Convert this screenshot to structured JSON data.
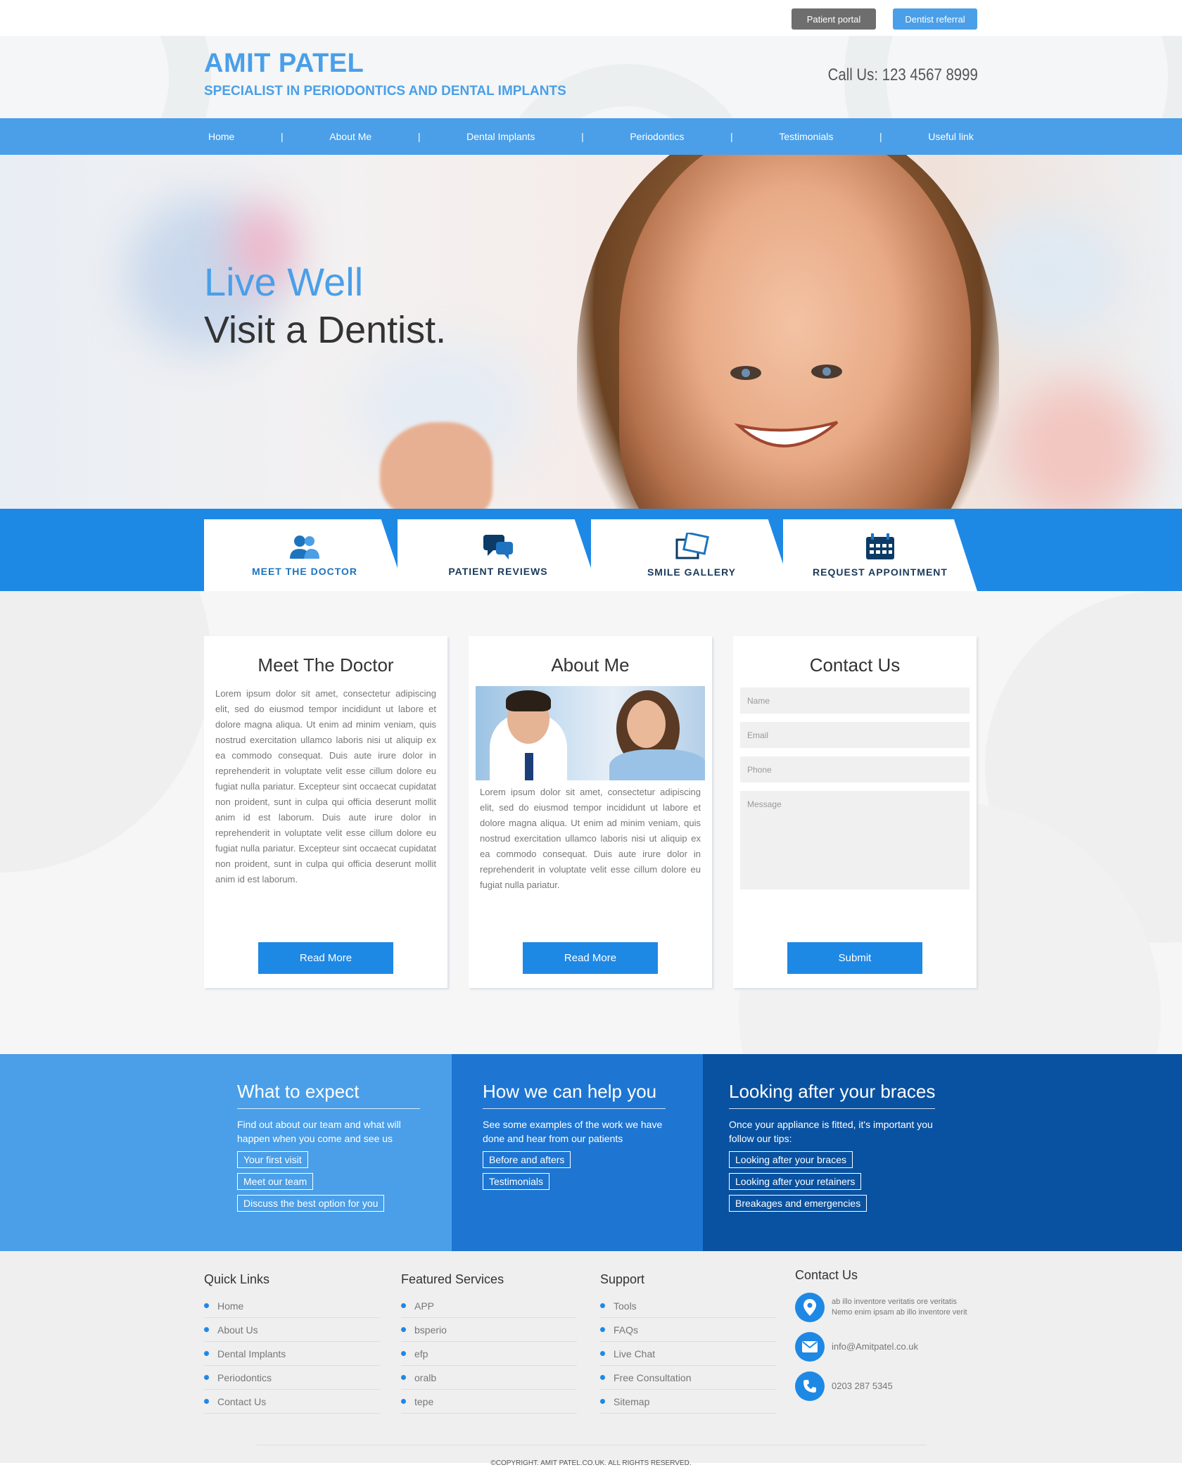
{
  "topbar": {
    "patient_portal": "Patient portal",
    "dentist_referral": "Dentist referral"
  },
  "header": {
    "name": "AMIT PATEL",
    "tagline": "SPECIALIST IN PERIODONTICS AND DENTAL IMPLANTS",
    "call": "Call Us: 123 4567 8999"
  },
  "nav": {
    "items": [
      "Home",
      "About Me",
      "Dental Implants",
      "Periodontics",
      "Testimonials",
      "Useful link"
    ],
    "separator": "|"
  },
  "hero": {
    "line1": "Live Well",
    "line2": "Visit a Dentist."
  },
  "tabs": [
    {
      "label": "MEET THE DOCTOR",
      "icon": "users-icon"
    },
    {
      "label": "PATIENT REVIEWS",
      "icon": "chat-bubbles-icon"
    },
    {
      "label": "SMILE GALLERY",
      "icon": "photos-icon"
    },
    {
      "label": "REQUEST APPOINTMENT",
      "icon": "calendar-icon"
    }
  ],
  "cards": {
    "doctor": {
      "title": "Meet The Doctor",
      "text": "Lorem ipsum dolor sit amet, consectetur adipiscing elit, sed do eiusmod tempor incididunt ut labore et dolore magna aliqua. Ut enim ad minim veniam, quis nostrud exercitation ullamco laboris nisi ut aliquip ex ea commodo consequat. Duis aute irure dolor in reprehenderit in voluptate velit esse cillum dolore eu fugiat nulla pariatur. Excepteur sint occaecat cupidatat non proident, sunt in culpa qui officia deserunt mollit anim id est laborum. Duis aute irure dolor in reprehenderit in voluptate velit esse cillum dolore eu fugiat nulla pariatur. Excepteur sint occaecat cupidatat non proident, sunt in culpa qui officia deserunt mollit anim id est laborum.",
      "button": "Read More"
    },
    "about": {
      "title": "About Me",
      "text": "Lorem ipsum dolor sit amet, consectetur adipiscing elit, sed do eiusmod tempor incididunt ut labore et dolore magna aliqua. Ut enim ad minim veniam, quis nostrud exercitation ullamco laboris nisi ut aliquip ex ea commodo consequat. Duis aute irure dolor in reprehenderit in voluptate velit esse cillum dolore eu fugiat nulla pariatur.",
      "button": "Read More"
    },
    "contact": {
      "title": "Contact Us",
      "name_ph": "Name",
      "email_ph": "Email",
      "phone_ph": "Phone",
      "message_ph": "Message",
      "button": "Submit"
    }
  },
  "band": {
    "expect": {
      "title": "What to expect",
      "desc": "Find out about our team and what will happen when you come and see us",
      "links": [
        "Your first visit",
        "Meet our team",
        "Discuss the best option for you"
      ]
    },
    "help": {
      "title": "How we can help you",
      "desc": "See some examples of the work we have done and hear from our patients",
      "links": [
        "Before and afters",
        "Testimonials"
      ]
    },
    "braces": {
      "title": "Looking after your braces",
      "desc": "Once your appliance is fitted, it's important you follow our tips:",
      "links": [
        "Looking after your braces",
        "Looking after your retainers",
        "Breakages and emergencies"
      ]
    }
  },
  "footer": {
    "quick": {
      "title": "Quick Links",
      "items": [
        "Home",
        "About Us",
        "Dental Implants",
        "Periodontics",
        "Contact Us"
      ]
    },
    "featured": {
      "title": "Featured Services",
      "items": [
        "APP",
        "bsperio",
        "efp",
        "oralb",
        "tepe"
      ]
    },
    "support": {
      "title": "Support",
      "items": [
        "Tools",
        "FAQs",
        "Live Chat",
        "Free Consultation",
        "Sitemap"
      ]
    },
    "contact": {
      "title": "Contact Us",
      "address": "ab illo inventore veritatis ore veritatis Nemo enim ipsam  ab illo inventore verit",
      "email": "info@Amitpatel.co.uk",
      "phone": "0203 287 5345"
    },
    "copyright": "©COPYRIGHT. AMIT PATEL.CO.UK. ALL RIGHTS RESERVED."
  },
  "colors": {
    "accent": "#4a9fe8",
    "primary": "#1e88e5",
    "band_mid": "#1e76d2",
    "band_dark": "#0952a1"
  }
}
